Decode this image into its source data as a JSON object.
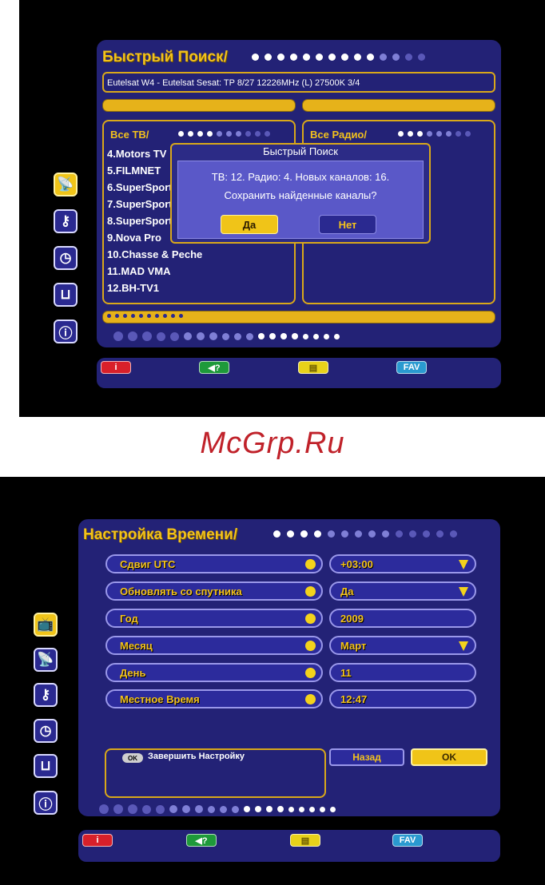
{
  "watermark": "McGrp.Ru",
  "screen1": {
    "title": "Быстрый Поиск/",
    "transponder": "Eutelsat W4 - Eutelsat Sesat: TP 8/27 12226MHz (L) 27500K 3/4",
    "tv_header": "Все ТВ/",
    "radio_header": "Все Радио/",
    "channels": [
      "4.Motors TV",
      "5.FILMNET",
      "6.SuperSport",
      "7.SuperSport",
      "8.SuperSport",
      "9.Nova Pro",
      "10.Chasse & Peche",
      "11.MAD VMA",
      "12.BH-TV1"
    ],
    "dialog": {
      "title": "Быстрый Поиск",
      "line1": "ТВ: 12. Радио: 4. Новых каналов: 16.",
      "line2": "Сохранить найденные каналы?",
      "yes": "Да",
      "no": "Нет"
    },
    "footer": {
      "red": "i",
      "green": "◀?",
      "yellow": "▤",
      "fav": "FAV"
    },
    "side_icons": [
      "satellite-icon",
      "key-icon",
      "clock-icon",
      "tools-icon",
      "info-icon"
    ]
  },
  "screen2": {
    "title": "Настройка Времени/",
    "rows": [
      {
        "label": "Сдвиг UTC",
        "value": "+03:00",
        "dropdown": true
      },
      {
        "label": "Обновлять со спутника",
        "value": "Да",
        "dropdown": true
      },
      {
        "label": "Год",
        "value": "2009",
        "dropdown": false
      },
      {
        "label": "Месяц",
        "value": "Март",
        "dropdown": true
      },
      {
        "label": "День",
        "value": "11",
        "dropdown": false
      },
      {
        "label": "Местное Время",
        "value": "12:47",
        "dropdown": false
      }
    ],
    "hint_key": "OK",
    "hint_text": "Завершить Настройку",
    "back": "Назад",
    "ok": "OK",
    "footer": {
      "red": "i",
      "green": "◀?",
      "yellow": "▤",
      "fav": "FAV"
    },
    "side_icons": [
      "tv-icon",
      "satellite-icon",
      "key-icon",
      "clock-icon",
      "tools-icon",
      "info-icon"
    ]
  },
  "colors": {
    "panel": "#232276",
    "accent": "#f3c21c",
    "screen_bg": "#000000",
    "red": "#d8202a",
    "green": "#1e9a3a",
    "yellow": "#e8d21a",
    "fav": "#2a9ad0"
  }
}
